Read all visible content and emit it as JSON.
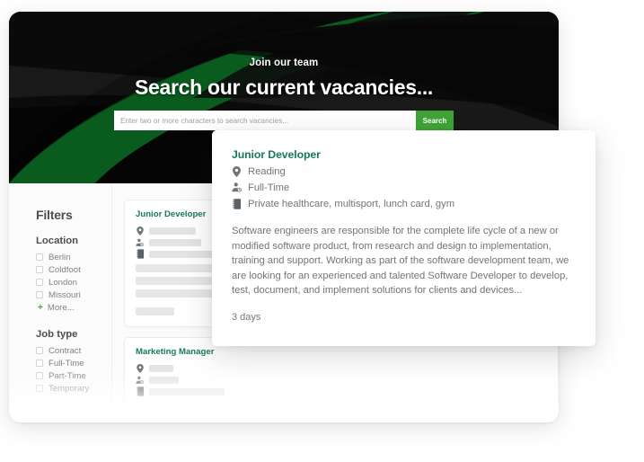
{
  "hero": {
    "eyebrow": "Join our team",
    "title": "Search our current vacancies...",
    "search_placeholder": "Enter two or more characters to search vacancies...",
    "search_value": "",
    "search_button": "Search",
    "bg_color": "#0a0a0a",
    "accent_green": "#0a5c1e",
    "button_green": "#3fa435"
  },
  "filters": {
    "title": "Filters",
    "groups": [
      {
        "heading": "Location",
        "options": [
          {
            "label": "Berlin",
            "checked": false
          },
          {
            "label": "Coldfoot",
            "checked": false
          },
          {
            "label": "London",
            "checked": false
          },
          {
            "label": "Missouri",
            "checked": false
          }
        ],
        "more_plus": "+",
        "more_label": "More..."
      },
      {
        "heading": "Job type",
        "options": [
          {
            "label": "Contract",
            "checked": false
          },
          {
            "label": "Full-Time",
            "checked": false
          },
          {
            "label": "Part-Time",
            "checked": false
          },
          {
            "label": "Temporary",
            "checked": false
          }
        ]
      }
    ]
  },
  "results": {
    "cards": [
      {
        "title": "Junior Developer"
      },
      {
        "title": "Marketing Manager"
      }
    ]
  },
  "detail": {
    "title": "Junior Developer",
    "location": "Reading",
    "job_type": "Full-Time",
    "benefits": "Private healthcare, multisport, lunch card, gym",
    "description": "Software engineers are responsible for the complete life cycle of a new or modified software product, from research and design to implementation, training and support. Working as part of the software development team, we are looking for an experienced and talented Software Developer to develop, test, document, and implement solutions for clients and devices...",
    "age": "3 days",
    "title_color": "#17795c",
    "icons": {
      "location": "map-pin-icon",
      "job_type": "person-clock-icon",
      "benefits": "benefits-card-icon"
    }
  }
}
